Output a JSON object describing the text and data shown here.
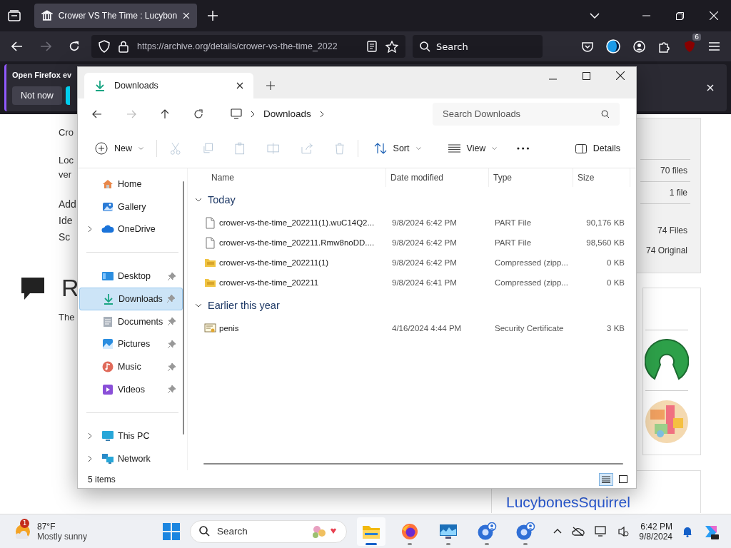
{
  "browser": {
    "tabs": [
      {
        "title": "Crower VS The Time : Lucybon",
        "selected": true
      }
    ],
    "url": "https://archive.org/details/crower-vs-the-time_2022",
    "search": {
      "placeholder": "Search"
    },
    "extension_badge": "6"
  },
  "banner": {
    "text": "Open Firefox ev",
    "button": "Not now"
  },
  "page": {
    "left_texts": [
      "Cro",
      "Loc",
      "ver"
    ],
    "left_texts_large": [
      "Add",
      "Ide",
      "Sc"
    ],
    "heading": "R",
    "paragraph": "The",
    "stats": [
      "70 files",
      "1 file",
      "74 Files",
      "74 Original"
    ],
    "uploader": "LucybonesSquirrel"
  },
  "explorer": {
    "tab": "Downloads",
    "breadcrumb": "Downloads",
    "search": {
      "placeholder": "Search Downloads"
    },
    "toolbar": {
      "new": "New",
      "sort": "Sort",
      "view": "View",
      "details": "Details"
    },
    "sidebar": [
      [
        {
          "label": "Home",
          "expandable": false,
          "pinned": false,
          "selected": false
        },
        {
          "label": "Gallery",
          "expandable": false,
          "pinned": false,
          "selected": false
        },
        {
          "label": "OneDrive",
          "expandable": true,
          "pinned": false,
          "selected": false
        }
      ],
      [
        {
          "label": "Desktop",
          "expandable": false,
          "pinned": true,
          "selected": false
        },
        {
          "label": "Downloads",
          "expandable": false,
          "pinned": true,
          "selected": true
        },
        {
          "label": "Documents",
          "expandable": false,
          "pinned": true,
          "selected": false
        },
        {
          "label": "Pictures",
          "expandable": false,
          "pinned": true,
          "selected": false
        },
        {
          "label": "Music",
          "expandable": false,
          "pinned": true,
          "selected": false
        },
        {
          "label": "Videos",
          "expandable": false,
          "pinned": true,
          "selected": false
        }
      ],
      [
        {
          "label": "This PC",
          "expandable": true,
          "pinned": false,
          "selected": false
        },
        {
          "label": "Network",
          "expandable": true,
          "pinned": false,
          "selected": false
        }
      ]
    ],
    "columns": [
      "Name",
      "Date modified",
      "Type",
      "Size"
    ],
    "groups": [
      {
        "label": "Today",
        "expanded": true,
        "files": [
          {
            "name": "crower-vs-the-time_202211(1).wuC14Q2...",
            "date": "9/8/2024 6:42 PM",
            "type": "PART File",
            "size": "90,176 KB",
            "kind": "file"
          },
          {
            "name": "crower-vs-the-time_202211.Rmw8noDD....",
            "date": "9/8/2024 6:42 PM",
            "type": "PART File",
            "size": "98,560 KB",
            "kind": "file"
          },
          {
            "name": "crower-vs-the-time_202211(1)",
            "date": "9/8/2024 6:42 PM",
            "type": "Compressed (zipp...",
            "size": "0 KB",
            "kind": "zip"
          },
          {
            "name": "crower-vs-the-time_202211",
            "date": "9/8/2024 6:41 PM",
            "type": "Compressed (zipp...",
            "size": "0 KB",
            "kind": "zip"
          }
        ]
      },
      {
        "label": "Earlier this year",
        "expanded": true,
        "files": [
          {
            "name": "penis",
            "date": "4/16/2024 4:44 PM",
            "type": "Security Certificate",
            "size": "3 KB",
            "kind": "certificate"
          }
        ]
      }
    ],
    "status": "5 items",
    "views": [
      {
        "kind": "details",
        "selected": true
      },
      {
        "kind": "tiles",
        "selected": false
      }
    ]
  },
  "taskbar": {
    "weather": {
      "badge": "1",
      "temp": "87°F",
      "condition": "Mostly sunny"
    },
    "search": {
      "placeholder": "Search"
    },
    "apps": [
      {
        "kind": "files",
        "active": true
      },
      {
        "kind": "firefox",
        "active": false
      },
      {
        "kind": "monitor",
        "active": false
      },
      {
        "kind": "chrome-profile",
        "active": false
      },
      {
        "kind": "chrome-profile",
        "active": false
      }
    ],
    "time": "6:42 PM",
    "date": "9/8/2024"
  }
}
